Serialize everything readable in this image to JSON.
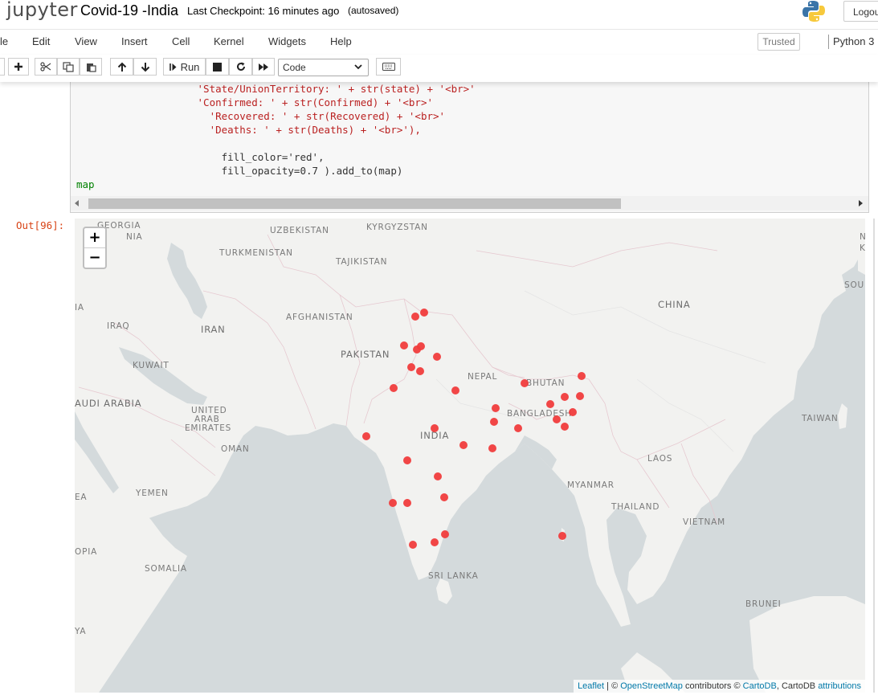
{
  "header": {
    "logo_text": "jupyter",
    "notebook_title": "Covid-19 -India",
    "checkpoint": "Last Checkpoint: 16 minutes ago",
    "autosaved": "(autosaved)",
    "logout_label": "Logou"
  },
  "menu": {
    "items": [
      "le",
      "Edit",
      "View",
      "Insert",
      "Cell",
      "Kernel",
      "Widgets",
      "Help"
    ],
    "trusted": "Trusted",
    "kernel": "Python 3"
  },
  "toolbar": {
    "run_label": "Run",
    "cell_type": "Code",
    "icons": [
      "save-icon",
      "add-cell-icon",
      "cut-icon",
      "copy-icon",
      "paste-icon",
      "move-up-icon",
      "move-down-icon",
      "run-icon",
      "stop-icon",
      "restart-icon",
      "fast-forward-icon",
      "keyboard-icon"
    ]
  },
  "code": {
    "lines": [
      "                    'State/UnionTerritory: ' + str(state) + '<br>'",
      "                    'Confirmed: ' + str(Confirmed) + '<br>'",
      "                      'Recovered: ' + str(Recovered) + '<br>'",
      "                      'Deaths: ' + str(Deaths) + '<br>'),",
      "",
      "                        fill_color='red',",
      "                        fill_opacity=0.7 ).add_to(map)",
      "map"
    ]
  },
  "output": {
    "prompt": "Out[96]:"
  },
  "map": {
    "zoom_in": "+",
    "zoom_out": "−",
    "marker_color": "#f03c3c",
    "land_color": "#f2f2f0",
    "water_color": "#d4dadc",
    "labels": [
      "GEORGIA",
      "NIA",
      "UZBEKISTAN",
      "KYRGYZSTAN",
      "TURKMENISTAN",
      "TAJIKISTAN",
      "N",
      "K",
      "SOU",
      "IA",
      "CHINA",
      "IRAQ",
      "IRAN",
      "AFGHANISTAN",
      "PAKISTAN",
      "KUWAIT",
      "NEPAL",
      "BHUTAN",
      "AUDI ARABIA",
      "UNITED",
      "ARAB",
      "EMIRATES",
      "BANGLADESH",
      "TAIWAN",
      "INDIA",
      "OMAN",
      "LAOS",
      "MYANMAR",
      "YEMEN",
      "EA",
      "THAILAND",
      "VIETNAM",
      "OPIA",
      "SOMALIA",
      "SRI LANKA",
      "BRUNEI",
      "YA"
    ],
    "attribution": {
      "leaflet": "Leaflet",
      "sep1": " | © ",
      "osm": "OpenStreetMap",
      "contrib": " contributors © ",
      "cartodb": "CartoDB",
      "mid": ", CartoDB ",
      "attr": "attributions"
    }
  }
}
